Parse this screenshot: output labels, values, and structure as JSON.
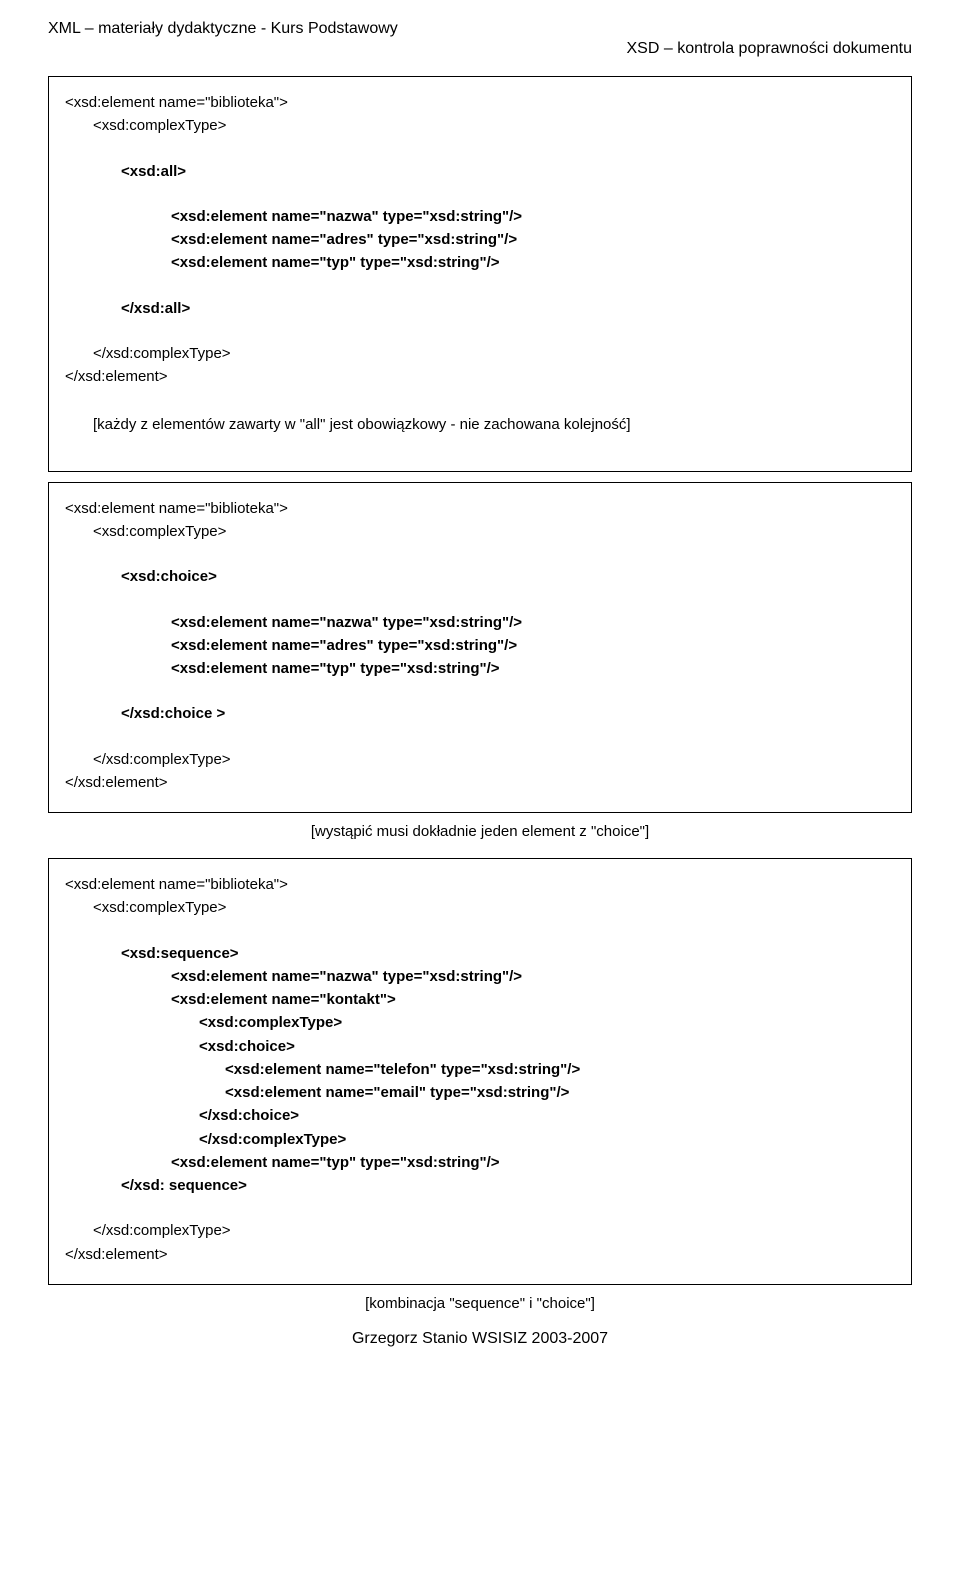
{
  "header": {
    "title": "XML – materiały dydaktyczne - Kurs Podstawowy",
    "subtitle": "XSD – kontrola poprawności  dokumentu"
  },
  "box1": {
    "l1": "<xsd:element name=\"biblioteka\">",
    "l2": "<xsd:complexType>",
    "l3": "<xsd:all>",
    "l4": "<xsd:element name=\"nazwa\" type=\"xsd:string\"/>",
    "l5": "<xsd:element name=\"adres\" type=\"xsd:string\"/>",
    "l6": "<xsd:element name=\"typ\" type=\"xsd:string\"/>",
    "l7": "</xsd:all>",
    "l8": "</xsd:complexType>",
    "l9": "</xsd:element>",
    "note": "[każdy z elementów zawarty w \"all\" jest obowiązkowy -  nie zachowana kolejność]"
  },
  "box2": {
    "l1": "<xsd:element name=\"biblioteka\">",
    "l2": "<xsd:complexType>",
    "l3": "<xsd:choice>",
    "l4": "<xsd:element name=\"nazwa\" type=\"xsd:string\"/>",
    "l5": "<xsd:element name=\"adres\" type=\"xsd:string\"/>",
    "l6": "<xsd:element name=\"typ\" type=\"xsd:string\"/>",
    "l7": "</xsd:choice >",
    "l8": "</xsd:complexType>",
    "l9": "</xsd:element>"
  },
  "note2": "[wystąpić musi dokładnie jeden element z \"choice\"]",
  "box3": {
    "l1": "<xsd:element name=\"biblioteka\">",
    "l2": "<xsd:complexType>",
    "l3": "<xsd:sequence>",
    "l4": "<xsd:element name=\"nazwa\" type=\"xsd:string\"/>",
    "l5": "<xsd:element name=\"kontakt\">",
    "l6": "<xsd:complexType>",
    "l7": "<xsd:choice>",
    "l8": "<xsd:element name=\"telefon\" type=\"xsd:string\"/>",
    "l9": "<xsd:element name=\"email\" type=\"xsd:string\"/>",
    "l10": "</xsd:choice>",
    "l11": "</xsd:complexType>",
    "l12": "<xsd:element name=\"typ\" type=\"xsd:string\"/>",
    "l13": "</xsd: sequence>",
    "l14": "</xsd:complexType>",
    "l15": "</xsd:element>"
  },
  "note3": "[kombinacja \"sequence\" i \"choice\"]",
  "footer": "Grzegorz Stanio WSISIZ 2003-2007"
}
